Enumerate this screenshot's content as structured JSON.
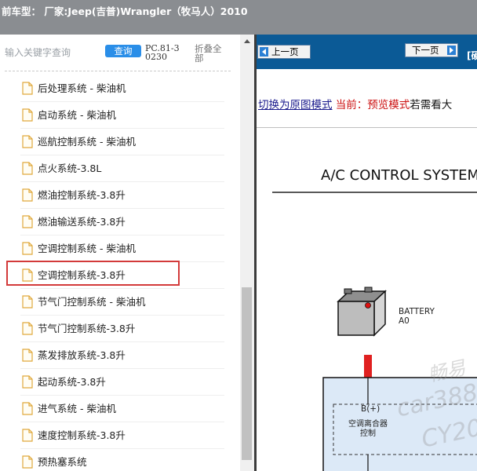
{
  "titlebar": {
    "prefix": "前车型：",
    "vehicle": " 厂家:Jeep(吉普)Wrangler（牧马人）2010"
  },
  "search": {
    "placeholder": "输入关键字查询",
    "query_label": "查询",
    "pc_code": "PC.81-30230",
    "collapse_label": "折叠全部"
  },
  "tree": {
    "items": [
      {
        "label": "后处理系统 - 柴油机"
      },
      {
        "label": "启动系统 - 柴油机"
      },
      {
        "label": "巡航控制系统 - 柴油机"
      },
      {
        "label": "点火系统-3.8L"
      },
      {
        "label": "燃油控制系统-3.8升"
      },
      {
        "label": "燃油输送系统-3.8升"
      },
      {
        "label": "空调控制系统 - 柴油机"
      },
      {
        "label": "空调控制系统-3.8升"
      },
      {
        "label": "节气门控制系统 - 柴油机"
      },
      {
        "label": "节气门控制系统-3.8升"
      },
      {
        "label": "蒸发排放系统-3.8升"
      },
      {
        "label": "起动系统-3.8升"
      },
      {
        "label": "进气系统 - 柴油机"
      },
      {
        "label": "速度控制系统-3.8升"
      },
      {
        "label": "预热塞系统"
      }
    ],
    "selected_index": 7
  },
  "viewer": {
    "prev_label": "上一页",
    "next_label": "下一页",
    "toolbar_extra": "[硬",
    "switch_link": "切换为原图模式",
    "current_mode": "当前：预览模式",
    "mode_note": "若需看大"
  },
  "diagram": {
    "title": "A/C CONTROL SYSTEM",
    "battery_label": "BATTERY",
    "battery_code": "A0",
    "pin_label": "B(+)",
    "module_label": "空调离合器控制",
    "watermark_1": "畅易",
    "watermark_2": "car388",
    "watermark_3": "CY20"
  },
  "colors": {
    "titlebar_bg": "#8a8d91",
    "toolbar_bg": "#0b5a96",
    "query_button": "#2a8ee8",
    "highlight": "#d33a3a",
    "wire_red": "#e02020"
  }
}
